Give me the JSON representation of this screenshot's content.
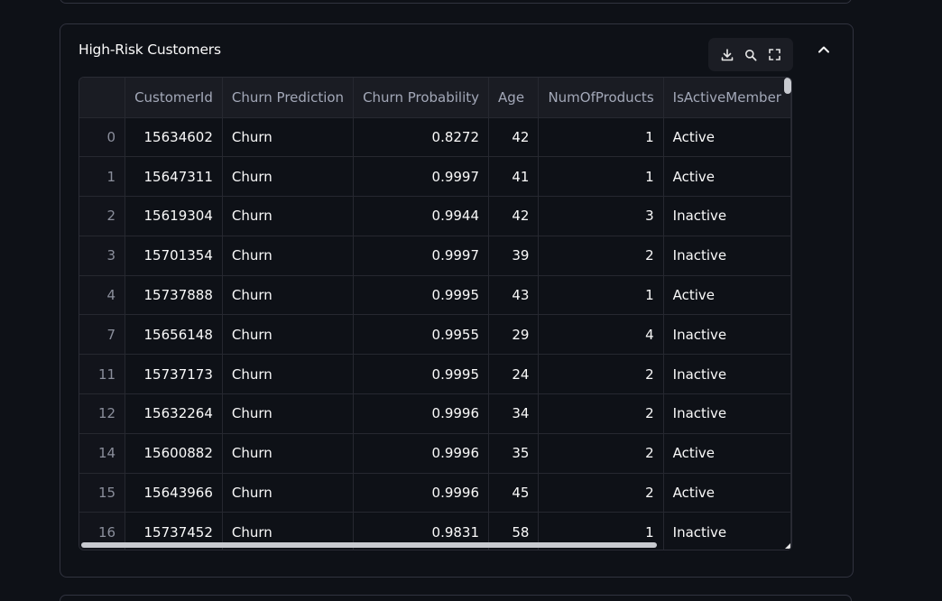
{
  "section": {
    "title": "High-Risk Customers"
  },
  "icons": {
    "download": "download-icon",
    "search": "search-icon",
    "fullscreen": "fullscreen-icon",
    "collapse": "chevron-up-icon"
  },
  "table": {
    "columns": [
      "",
      "CustomerId",
      "Churn Prediction",
      "Churn Probability",
      "Age",
      "NumOfProducts",
      "IsActiveMember"
    ],
    "rows": [
      [
        "0",
        "15634602",
        "Churn",
        "0.8272",
        "42",
        "1",
        "Active"
      ],
      [
        "1",
        "15647311",
        "Churn",
        "0.9997",
        "41",
        "1",
        "Active"
      ],
      [
        "2",
        "15619304",
        "Churn",
        "0.9944",
        "42",
        "3",
        "Inactive"
      ],
      [
        "3",
        "15701354",
        "Churn",
        "0.9997",
        "39",
        "2",
        "Inactive"
      ],
      [
        "4",
        "15737888",
        "Churn",
        "0.9995",
        "43",
        "1",
        "Active"
      ],
      [
        "7",
        "15656148",
        "Churn",
        "0.9955",
        "29",
        "4",
        "Inactive"
      ],
      [
        "11",
        "15737173",
        "Churn",
        "0.9995",
        "24",
        "2",
        "Inactive"
      ],
      [
        "12",
        "15632264",
        "Churn",
        "0.9996",
        "34",
        "2",
        "Inactive"
      ],
      [
        "14",
        "15600882",
        "Churn",
        "0.9996",
        "35",
        "2",
        "Active"
      ],
      [
        "15",
        "15643966",
        "Churn",
        "0.9996",
        "45",
        "2",
        "Active"
      ],
      [
        "16",
        "15737452",
        "Churn",
        "0.9831",
        "58",
        "1",
        "Inactive"
      ]
    ]
  },
  "colors": {
    "background": "#0e1117",
    "text": "#fafafa",
    "header_text": "#a3a8b8",
    "border": "#31333f"
  }
}
